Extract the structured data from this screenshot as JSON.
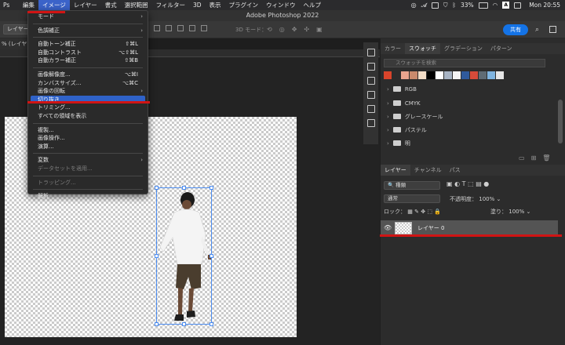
{
  "menubar": {
    "items": [
      "Ps",
      "編集",
      "イメージ",
      "レイヤー",
      "書式",
      "選択範囲",
      "フィルター",
      "3D",
      "表示",
      "プラグイン",
      "ウィンドウ",
      "ヘルプ"
    ],
    "battery": "33%",
    "clock": "Mon 20:55"
  },
  "titlebar": {
    "title": "Adobe Photoshop 2022"
  },
  "options": {
    "layer_select": "レイヤー",
    "mode3d": "3D モード：",
    "share": "共有"
  },
  "doc": {
    "tab": "% (レイヤー"
  },
  "image_menu": {
    "items": [
      {
        "label": "モード",
        "submenu": true
      },
      {
        "sep": true
      },
      {
        "label": "色調補正",
        "submenu": true
      },
      {
        "sep": true
      },
      {
        "label": "自動トーン補正",
        "shortcut": "⇧⌘L"
      },
      {
        "label": "自動コントラスト",
        "shortcut": "⌥⇧⌘L"
      },
      {
        "label": "自動カラー補正",
        "shortcut": "⇧⌘B"
      },
      {
        "sep": true
      },
      {
        "label": "画像解像度...",
        "shortcut": "⌥⌘I"
      },
      {
        "label": "カンバスサイズ...",
        "shortcut": "⌥⌘C"
      },
      {
        "label": "画像の回転",
        "submenu": true
      },
      {
        "label": "切り抜き",
        "highlighted": true
      },
      {
        "label": "トリミング..."
      },
      {
        "label": "すべての領域を表示"
      },
      {
        "sep": true
      },
      {
        "label": "複製..."
      },
      {
        "label": "画像操作..."
      },
      {
        "label": "演算..."
      },
      {
        "sep": true
      },
      {
        "label": "変数",
        "submenu": true
      },
      {
        "label": "データセットを適用...",
        "disabled": true
      },
      {
        "sep": true
      },
      {
        "label": "トラッピング...",
        "disabled": true
      },
      {
        "sep": true
      },
      {
        "label": "解析",
        "submenu": true
      }
    ]
  },
  "swatches_panel": {
    "tabs": [
      "カラー",
      "スウォッチ",
      "グラデーション",
      "パターン"
    ],
    "active_tab": "スウォッチ",
    "search_placeholder": "スウォッチを検索",
    "swatch_colors": [
      "#d9442b",
      "#2c2c2c",
      "#e8a48e",
      "#c98a6c",
      "#f2dcc6",
      "#000000",
      "#ffffff",
      "#a8b4c4",
      "#f4f4f4",
      "#2f5a9c",
      "#d64b3a",
      "#5f6b74",
      "#7fb4e0",
      "#e6e6e6"
    ],
    "folders": [
      "RGB",
      "CMYK",
      "グレースケール",
      "パステル",
      "明"
    ]
  },
  "layers_panel": {
    "tabs": [
      "レイヤー",
      "チャンネル",
      "パス"
    ],
    "active_tab": "レイヤー",
    "filter": "種類",
    "blend_mode": "通常",
    "opacity_label": "不透明度：",
    "opacity": "100%",
    "lock_label": "ロック：",
    "fill_label": "塗り：",
    "fill": "100%",
    "layer_name": "レイヤー 0"
  }
}
